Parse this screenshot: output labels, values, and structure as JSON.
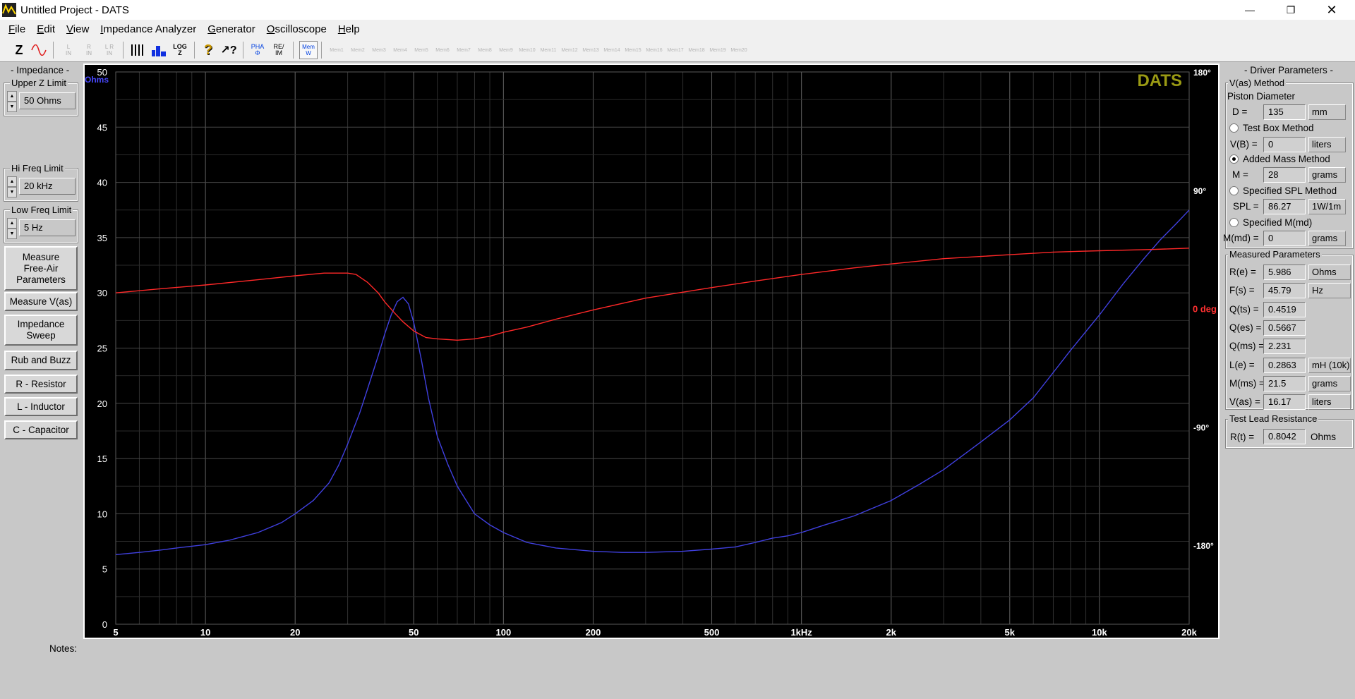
{
  "window": {
    "title": "Untitled Project - DATS",
    "minimize_glyph": "—",
    "maximize_glyph": "❐",
    "close_glyph": "✕"
  },
  "menu": [
    {
      "key": "F",
      "rest": "ile"
    },
    {
      "key": "E",
      "rest": "dit"
    },
    {
      "key": "V",
      "rest": "iew"
    },
    {
      "key": "I",
      "rest": "mpedance Analyzer"
    },
    {
      "key": "G",
      "rest": "enerator"
    },
    {
      "key": "O",
      "rest": "scilloscope"
    },
    {
      "key": "H",
      "rest": "elp"
    }
  ],
  "toolbar": {
    "z_label": "Z",
    "l_labels": [
      "L\nIN",
      "R\nIN",
      "L R\nIN"
    ],
    "log_label": "LOG\nZ",
    "help_label": "?",
    "context_help_label": "↗?",
    "pha_label": "PHA\nΦ",
    "reim_label": "RE/\nIM",
    "mem_w_label": "Mem\nW",
    "mem_slots": [
      "1",
      "2",
      "3",
      "4",
      "5",
      "6",
      "7",
      "8",
      "9",
      "10",
      "11",
      "12",
      "13",
      "14",
      "15",
      "16",
      "17",
      "18",
      "19",
      "20"
    ],
    "mem_prefix": "Mem"
  },
  "left_panel": {
    "impedance_title": "- Impedance -",
    "upper_z": {
      "label": "Upper Z Limit",
      "value": "50 Ohms"
    },
    "hi_freq": {
      "label": "Hi Freq Limit",
      "value": "20 kHz"
    },
    "low_freq": {
      "label": "Low Freq Limit",
      "value": "5 Hz"
    },
    "buttons": [
      "Measure\nFree-Air\nParameters",
      "Measure V(as)",
      "Impedance\nSweep",
      "Rub and Buzz",
      "R - Resistor",
      "L - Inductor",
      "C - Capacitor"
    ]
  },
  "right_panel": {
    "title": "- Driver Parameters -",
    "vas_method_title": "V(as) Method",
    "piston_diameter_label": "Piston Diameter",
    "d": {
      "label": "D  =",
      "value": "135",
      "unit": "mm"
    },
    "test_box": {
      "label": "Test Box Method",
      "selected": false
    },
    "vb": {
      "label": "V(B) =",
      "value": "0",
      "unit": "liters"
    },
    "added_mass": {
      "label": "Added Mass Method",
      "selected": true
    },
    "m": {
      "label": "M  =",
      "value": "28",
      "unit": "grams"
    },
    "specified_spl": {
      "label": "Specified SPL Method",
      "selected": false
    },
    "spl": {
      "label": "SPL =",
      "value": "86.27",
      "unit": "1W/1m"
    },
    "specified_mmd": {
      "label": "Specified M(md)",
      "selected": false
    },
    "mmd": {
      "label": "M(md) =",
      "value": "0",
      "unit": "grams"
    },
    "measured_title": "Measured Parameters",
    "measured": [
      {
        "label": "R(e) =",
        "value": "5.986",
        "unit": "Ohms"
      },
      {
        "label": "F(s) =",
        "value": "45.79",
        "unit": "Hz"
      },
      {
        "label": "Q(ts) =",
        "value": "0.4519",
        "unit": ""
      },
      {
        "label": "Q(es) =",
        "value": "0.5667",
        "unit": ""
      },
      {
        "label": "Q(ms) =",
        "value": "2.231",
        "unit": ""
      },
      {
        "label": "L(e) =",
        "value": "0.2863",
        "unit": "mH (10k)"
      },
      {
        "label": "M(ms) =",
        "value": "21.5",
        "unit": "grams"
      },
      {
        "label": "V(as) =",
        "value": "16.17",
        "unit": "liters"
      }
    ],
    "lead_title": "Test Lead Resistance",
    "lead": {
      "label": "R(t) =",
      "value": "0.8042",
      "unit": "Ohms"
    }
  },
  "notes_label": "Notes:",
  "chart_data": {
    "type": "line",
    "watermark": "DATS",
    "x_scale": "log",
    "xlim": [
      5,
      20000
    ],
    "x_ticks": [
      {
        "v": 5,
        "label": "5"
      },
      {
        "v": 10,
        "label": "10"
      },
      {
        "v": 20,
        "label": "20"
      },
      {
        "v": 50,
        "label": "50"
      },
      {
        "v": 100,
        "label": "100"
      },
      {
        "v": 200,
        "label": "200"
      },
      {
        "v": 500,
        "label": "500"
      },
      {
        "v": 1000,
        "label": "1kHz"
      },
      {
        "v": 2000,
        "label": "2k"
      },
      {
        "v": 5000,
        "label": "5k"
      },
      {
        "v": 10000,
        "label": "10k"
      },
      {
        "v": 20000,
        "label": "20k"
      }
    ],
    "y_left": {
      "unit_label": "Ohms",
      "lim": [
        0,
        50
      ],
      "ticks": [
        "0",
        "5",
        "10",
        "15",
        "20",
        "25",
        "30",
        "35",
        "40",
        "45",
        "50"
      ],
      "color": "#4848ff"
    },
    "y_right": {
      "unit_label": "0 deg",
      "lim": [
        -240,
        180
      ],
      "ticks": [
        {
          "v": 180,
          "label": "180°"
        },
        {
          "v": 90,
          "label": "90°"
        },
        {
          "v": -90,
          "label": "-90°"
        },
        {
          "v": -180,
          "label": "-180°"
        }
      ],
      "color": "#ff3030"
    },
    "grid": true,
    "series": [
      {
        "axis": "left",
        "color": "#4040e0",
        "x": [
          5,
          6,
          7,
          8,
          10,
          12,
          15,
          18,
          20,
          23,
          26,
          28,
          30,
          33,
          35,
          38,
          40,
          42,
          44,
          46,
          48,
          50,
          53,
          56,
          60,
          65,
          70,
          75,
          80,
          90,
          100,
          120,
          150,
          200,
          250,
          300,
          400,
          500,
          600,
          700,
          800,
          900,
          1000,
          1200,
          1500,
          2000,
          2500,
          3000,
          4000,
          5000,
          6000,
          7000,
          8000,
          10000,
          12000,
          14000,
          16000,
          18000,
          20000
        ],
        "y": [
          6.3,
          6.5,
          6.7,
          6.9,
          7.2,
          7.6,
          8.3,
          9.2,
          10.0,
          11.2,
          12.8,
          14.4,
          16.3,
          19.2,
          21.3,
          24.3,
          26.3,
          28.0,
          29.2,
          29.6,
          29.0,
          27.3,
          24.0,
          20.5,
          17.0,
          14.5,
          12.5,
          11.2,
          10.0,
          9.0,
          8.3,
          7.4,
          6.9,
          6.6,
          6.5,
          6.5,
          6.6,
          6.8,
          7.0,
          7.4,
          7.8,
          8.0,
          8.3,
          9.0,
          9.8,
          11.2,
          12.7,
          14.0,
          16.5,
          18.5,
          20.5,
          22.8,
          24.8,
          28.0,
          30.8,
          33.0,
          34.8,
          36.2,
          37.5
        ]
      },
      {
        "axis": "right",
        "color": "#ff2828",
        "x": [
          5,
          7,
          10,
          15,
          20,
          25,
          30,
          32,
          35,
          38,
          40,
          43,
          46,
          50,
          55,
          60,
          70,
          80,
          90,
          100,
          120,
          150,
          200,
          300,
          500,
          700,
          1000,
          1500,
          2000,
          3000,
          5000,
          7000,
          10000,
          15000,
          20000
        ],
        "y": [
          12,
          15,
          18,
          22,
          25,
          27,
          27,
          26,
          20,
          12,
          5,
          -3,
          -10,
          -17,
          -22,
          -23,
          -24,
          -23,
          -21,
          -18,
          -14,
          -8,
          -1,
          8,
          16,
          21,
          26,
          31,
          34,
          38,
          41,
          43,
          44,
          45,
          46
        ]
      }
    ]
  }
}
